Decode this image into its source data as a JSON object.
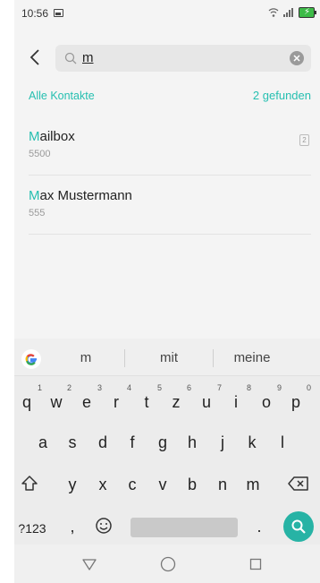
{
  "status": {
    "time": "10:56"
  },
  "search": {
    "query": "m"
  },
  "section": {
    "left_label": "Alle Kontakte",
    "right_label": "2 gefunden"
  },
  "contacts": [
    {
      "name_hl": "M",
      "name_rest": "ailbox",
      "number": "5500",
      "sim": "2"
    },
    {
      "name_hl": "M",
      "name_rest": "ax Mustermann",
      "number": "555"
    }
  ],
  "keyboard": {
    "suggestions": [
      "m",
      "mit",
      "meine"
    ],
    "row1": [
      {
        "k": "q",
        "n": "1"
      },
      {
        "k": "w",
        "n": "2"
      },
      {
        "k": "e",
        "n": "3"
      },
      {
        "k": "r",
        "n": "4"
      },
      {
        "k": "t",
        "n": "5"
      },
      {
        "k": "z",
        "n": "6"
      },
      {
        "k": "u",
        "n": "7"
      },
      {
        "k": "i",
        "n": "8"
      },
      {
        "k": "o",
        "n": "9"
      },
      {
        "k": "p",
        "n": "0"
      }
    ],
    "row2": [
      "a",
      "s",
      "d",
      "f",
      "g",
      "h",
      "j",
      "k",
      "l"
    ],
    "row3": [
      "y",
      "x",
      "c",
      "v",
      "b",
      "n",
      "m"
    ],
    "symbols_label": "?123",
    "comma": ",",
    "period": "."
  },
  "colors": {
    "accent": "#25bfb0",
    "search_key": "#27b3a5"
  },
  "icons": [
    "back-icon",
    "search-icon",
    "clear-icon",
    "shift-icon",
    "backspace-icon",
    "emoji-icon",
    "google-icon",
    "nav-back-icon",
    "nav-home-icon",
    "nav-recents-icon"
  ]
}
